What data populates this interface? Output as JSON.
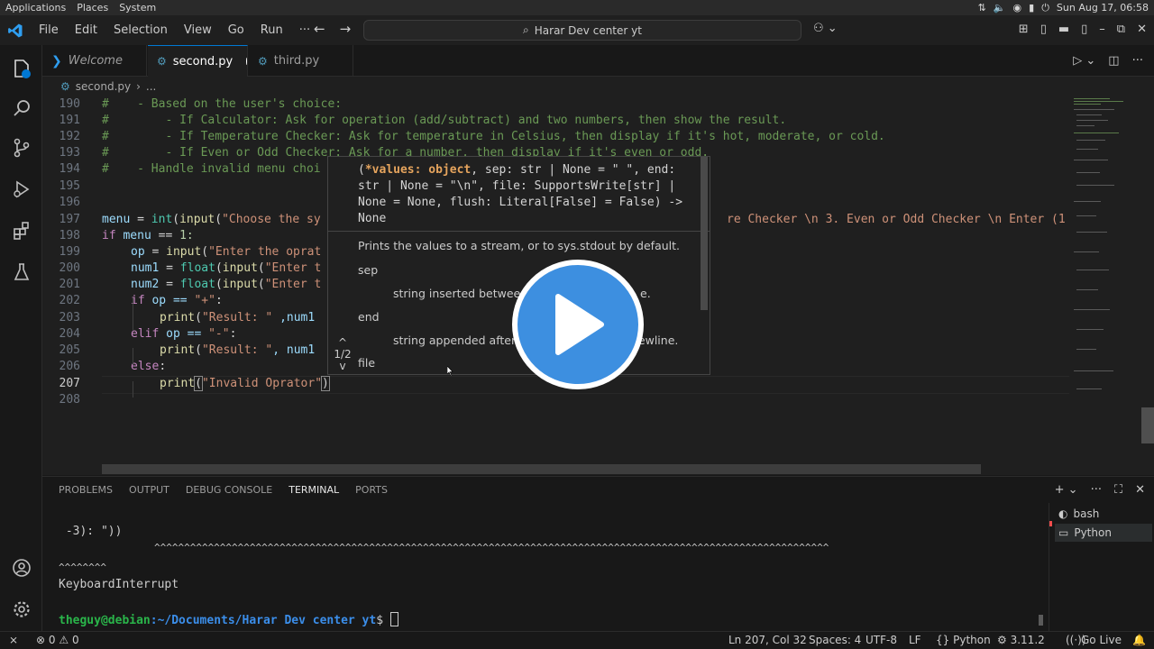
{
  "system_bar": {
    "menus": [
      "Applications",
      "Places",
      "System"
    ],
    "clock": "Sun Aug 17, 06:58"
  },
  "titlebar": {
    "menus": [
      "File",
      "Edit",
      "Selection",
      "View",
      "Go",
      "Run",
      "···"
    ],
    "search_text": "Harar Dev center yt"
  },
  "tabs": [
    {
      "label": "Welcome",
      "icon": "vscode-icon"
    },
    {
      "label": "second.py",
      "icon": "python-icon",
      "modified": true
    },
    {
      "label": "third.py",
      "icon": "python-icon"
    }
  ],
  "breadcrumb": {
    "file": "second.py",
    "sep": "›",
    "more": "..."
  },
  "editor": {
    "current_line": "207",
    "lines": [
      {
        "n": "190",
        "t": "#    - Based on the user's choice:"
      },
      {
        "n": "191",
        "t": "#        - If Calculator: Ask for operation (add/subtract) and two numbers, then show the result."
      },
      {
        "n": "192",
        "t": "#        - If Temperature Checker: Ask for temperature in Celsius, then display if it's hot, moderate, or cold."
      },
      {
        "n": "193",
        "t": "#        - If Even or Odd Checker: Ask for a number, then display if it's even or odd."
      },
      {
        "n": "194",
        "t": "#    - Handle invalid menu choi"
      },
      {
        "n": "195",
        "t": ""
      },
      {
        "n": "196",
        "t": ""
      },
      {
        "n": "197",
        "a": "menu",
        "b": " = ",
        "c": "int",
        "d": "(",
        "e": "input",
        "f": "(",
        "g": "\"Choose the sy",
        "h": "re Checker \\n 3. Even or Odd Checker \\n Enter (1 -"
      },
      {
        "n": "198",
        "a": "if",
        "b": " menu ",
        "c": "==",
        "d": " 1:"
      },
      {
        "n": "199",
        "a": "op",
        "b": " = ",
        "c": "input",
        "d": "(",
        "e": "\"Enter the oprat"
      },
      {
        "n": "200",
        "a": "num1",
        "b": " = ",
        "c": "float",
        "d": "(",
        "e": "input",
        "f": "(",
        "g": "\"Enter t"
      },
      {
        "n": "201",
        "a": "num2",
        "b": " = ",
        "c": "float",
        "d": "(",
        "e": "input",
        "f": "(",
        "g": "\"Enter t"
      },
      {
        "n": "202",
        "a": "if",
        "b": " op == ",
        "c": "\"+\"",
        "d": ":"
      },
      {
        "n": "203",
        "a": "print",
        "b": "(",
        "c": "\"Result: \"",
        "d": " ,num1"
      },
      {
        "n": "204",
        "a": "elif",
        "b": " op == ",
        "c": "\"-\"",
        "d": ":"
      },
      {
        "n": "205",
        "a": "print",
        "b": "(",
        "c": "\"Result: \"",
        "d": ", num1"
      },
      {
        "n": "206",
        "a": "else",
        "b": ":"
      },
      {
        "n": "207",
        "a": "print",
        "b": "(",
        "c": "\"Invalid Oprator\"",
        "d": ")"
      },
      {
        "n": "208",
        "t": ""
      }
    ]
  },
  "hover": {
    "sig_bold": "*values: object",
    "sig_rest": ", sep: str | None = \" \", end: str | None = \"\\n\", file: SupportsWrite[str] | None = None, flush: Literal[False] = False) -> None",
    "sig_open": "(",
    "description": "Prints the values to a stream, or to sys.stdout by default.",
    "p1_name": "sep",
    "p1_desc": "string inserted between",
    "p1_tail": "e.",
    "p2_name": "end",
    "p2_desc": "string appended after t",
    "p2_tail": "newline.",
    "p3_name": "file",
    "pager": "1/2",
    "pager_up": "^",
    "pager_down": "v"
  },
  "panel": {
    "tabs": [
      "PROBLEMS",
      "OUTPUT",
      "DEBUG CONSOLE",
      "TERMINAL",
      "PORTS"
    ],
    "active_tab": "TERMINAL"
  },
  "terminal": {
    "lines": [
      " -3): \"))",
      "                ^^^^^^^^^^^^^^^^^^^^^^^^^^^^^^^^^^^^^^^^^^^^^^^^^^^^^^^^^^^^^^^^^^^^^^^^^^^^^^^^^^^^^^^^^^^^^^^^^^^^^^^^^^^^^^^^^",
      "^^^^^^^^",
      "KeyboardInterrupt"
    ],
    "prompt_user": "theguy@debian",
    "prompt_path": ":~/Documents/Harar Dev center yt",
    "prompt_symbol": "$",
    "instances": [
      "bash",
      "Python"
    ]
  },
  "statusbar": {
    "errors": "0",
    "warnings": "0",
    "position": "Ln 207, Col 32",
    "spaces": "Spaces: 4",
    "encoding": "UTF-8",
    "eol": "LF",
    "language_braces": "{}",
    "language": "Python",
    "interpreter": "3.11.2",
    "golive": "Go Live"
  },
  "colors": {
    "accent": "#0078d4",
    "play_button": "#3d8fe0",
    "comment": "#6a9955",
    "keyword": "#c586c0",
    "function": "#dcdcaa",
    "string": "#ce9178",
    "prompt_green": "#2ab54a",
    "prompt_blue": "#3b8eea"
  }
}
